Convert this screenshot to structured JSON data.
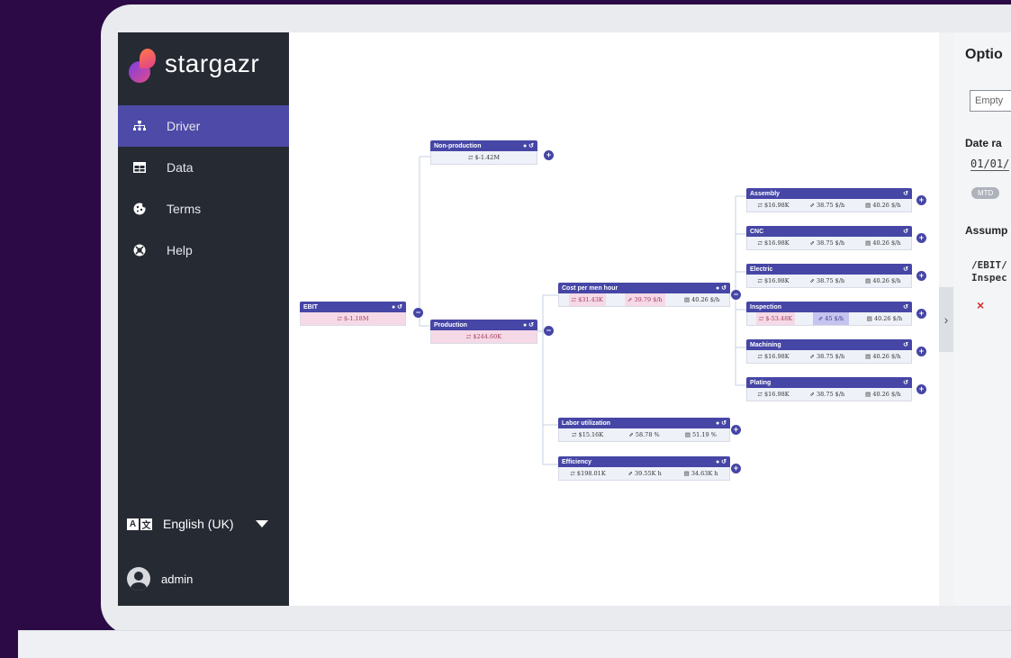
{
  "app": {
    "name": "stargazr"
  },
  "sidebar": {
    "items": [
      {
        "label": "Driver",
        "icon": "hierarchy-icon",
        "active": true
      },
      {
        "label": "Data",
        "icon": "table-icon",
        "active": false
      },
      {
        "label": "Terms",
        "icon": "cookie-icon",
        "active": false
      },
      {
        "label": "Help",
        "icon": "lifebuoy-icon",
        "active": false
      }
    ],
    "language": "English (UK)",
    "user": "admin"
  },
  "tree": {
    "ebit": {
      "title": "EBIT",
      "value": "⇄ $-1.18M"
    },
    "non_production": {
      "title": "Non-production",
      "value": "⇄ $-1.42M"
    },
    "production": {
      "title": "Production",
      "value": "⇄ $244.60K"
    },
    "cost_per_men_hour": {
      "title": "Cost per men hour",
      "v1": "⇄ $31.43K",
      "v2": "⇗ 39.79 $/h",
      "v3": "▤ 40.26 $/h"
    },
    "labor_utilization": {
      "title": "Labor utilization",
      "v1": "⇄ $15.16K",
      "v2": "⇗ 58.78 %",
      "v3": "▤ 51.19 %"
    },
    "efficiency": {
      "title": "Efficiency",
      "v1": "⇄ $198.01K",
      "v2": "⇗ 39.55K h",
      "v3": "▤ 34.63K h"
    },
    "assembly": {
      "title": "Assembly",
      "v1": "⇄ $16.98K",
      "v2": "⇗ 38.75 $/h",
      "v3": "▤ 40.26 $/h"
    },
    "cnc": {
      "title": "CNC",
      "v1": "⇄ $16.98K",
      "v2": "⇗ 38.75 $/h",
      "v3": "▤ 40.26 $/h"
    },
    "electric": {
      "title": "Electric",
      "v1": "⇄ $16.98K",
      "v2": "⇗ 38.75 $/h",
      "v3": "▤ 40.26 $/h"
    },
    "inspection": {
      "title": "Inspection",
      "v1": "⇄ $-53.48K",
      "v2": "⇗ 45 $/h",
      "v3": "▤ 40.26 $/h"
    },
    "machining": {
      "title": "Machining",
      "v1": "⇄ $16.98K",
      "v2": "⇗ 38.75 $/h",
      "v3": "▤ 40.26 $/h"
    },
    "plating": {
      "title": "Plating",
      "v1": "⇄ $16.98K",
      "v2": "⇗ 38.75 $/h",
      "v3": "▤ 40.26 $/h"
    }
  },
  "panel": {
    "title": "Optio",
    "input_value": "Empty",
    "date_label": "Date ra",
    "date_value": "01/01/",
    "chip": "MTD",
    "assumptions_label": "Assump",
    "path_line1": "/EBIT/",
    "path_line2": "Inspec",
    "remove": "×"
  },
  "toggle": {
    "label": "›"
  }
}
